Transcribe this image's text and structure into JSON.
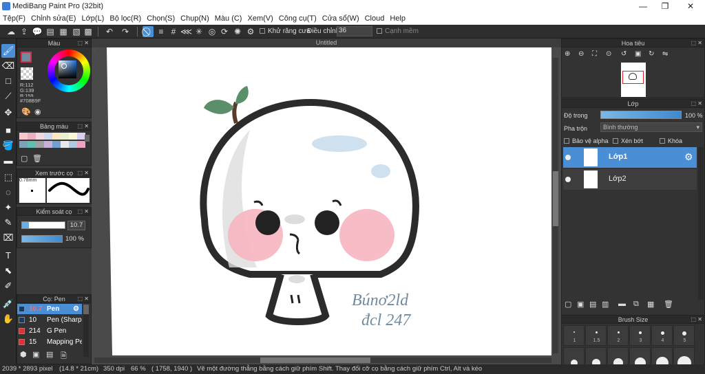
{
  "window": {
    "title": "MediBang Paint Pro (32bit)",
    "minimize": "—",
    "restore": "❐",
    "close": "✕"
  },
  "menu": [
    "Tệp(F)",
    "Chỉnh sửa(E)",
    "Lớp(L)",
    "Bộ lọc(R)",
    "Chọn(S)",
    "Chụp(N)",
    "Màu (C)",
    "Xem(V)",
    "Công cụ(T)",
    "Cửa sổ(W)",
    "Cloud",
    "Help"
  ],
  "toolbar": {
    "antialias_label": "Khử răng cưa",
    "adjust_label": "Điều chỉnh",
    "adjust_value": "36",
    "edge_label": "Cạnh mềm"
  },
  "color_panel": {
    "title": "Màu",
    "r": "R:112",
    "g": "G:139",
    "b": "B:159",
    "hex": "#708B9F",
    "fg": "#708b9f"
  },
  "palette_panel": {
    "title": "Bảng màu",
    "colors": [
      "#f7c8d0",
      "#e8b0c0",
      "#f0d8e0",
      "#d0d8f0",
      "#f8e8c8",
      "#e8f0d0",
      "#f8f8d8",
      "#d8d0f0",
      "#80a0b8",
      "#60c0b0",
      "#a0a0a0",
      "#c8b0d8",
      "#70a0d0",
      "#e8e8e8",
      "#b0c8e0",
      "#f0a0c0"
    ]
  },
  "brush_preview": {
    "title": "Xem trước cọ",
    "size": "0.78mm"
  },
  "brush_control": {
    "title": "Kiểm soát cọ",
    "size": "10.7",
    "opacity": "100 %"
  },
  "brush_list": {
    "title": "Cọ: Pen",
    "items": [
      {
        "size": "10.7",
        "name": "Pen",
        "color": "#1e3a5a",
        "selected": true
      },
      {
        "size": "10",
        "name": "Pen (Sharp",
        "color": "#1e3a5a",
        "selected": false
      },
      {
        "size": "214",
        "name": "G Pen",
        "color": "#e03030",
        "selected": false
      },
      {
        "size": "15",
        "name": "Mapping Pe",
        "color": "#e03030",
        "selected": false
      }
    ]
  },
  "document": {
    "title": "Untitled",
    "signature_line1": "Búnơ2ld",
    "signature_line2": "đcl 247"
  },
  "navigator": {
    "title": "Hoa tiêu"
  },
  "layer_panel": {
    "title": "Lớp",
    "opacity_label": "Độ trong",
    "opacity_value": "100 %",
    "blend_label": "Pha trộn",
    "blend_value": "Bình thường",
    "protect_alpha": "Bảo vệ alpha",
    "clipping": "Xén bớt",
    "lock": "Khóa",
    "layers": [
      {
        "name": "Lớp1",
        "selected": true
      },
      {
        "name": "Lớp2",
        "selected": false
      }
    ]
  },
  "brush_size_panel": {
    "title": "Brush Size",
    "sizes": [
      "1",
      "1.5",
      "2",
      "3",
      "4",
      "5"
    ]
  },
  "status": {
    "dims": "2039 * 2893 pixel",
    "physical": "(14.8 * 21cm)",
    "dpi": "350 dpi",
    "zoom": "66 %",
    "coords": "( 1758, 1940 )",
    "hint": "Vẽ một đường thẳng bằng cách giữ phím Shift. Thay đổi cỡ cọ bằng cách giữ phím Ctrl, Alt và kéo"
  }
}
